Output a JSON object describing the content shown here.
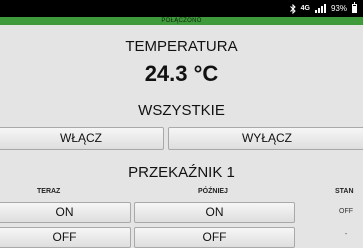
{
  "status_bar": {
    "network": "4G",
    "battery": "93%",
    "icons": [
      "bluetooth-icon",
      "signal-icon",
      "battery-icon"
    ]
  },
  "connection_banner": "POŁĄCZONO",
  "temperature": {
    "title": "TEMPERATURA",
    "value": "24.3 °C"
  },
  "all": {
    "title": "WSZYSTKIE",
    "on_label": "WŁĄCZ",
    "off_label": "WYŁĄCZ"
  },
  "relay": {
    "title": "PRZEKAŹNIK 1",
    "col_now": "TERAZ",
    "col_later": "PÓŹNIEJ",
    "col_state": "STAN",
    "rows": [
      {
        "now": "ON",
        "later": "ON",
        "state": "OFF"
      },
      {
        "now": "OFF",
        "later": "OFF",
        "state": "-"
      }
    ]
  },
  "colors": {
    "connected": "#3f9a3c",
    "background": "#e4e4e4"
  }
}
